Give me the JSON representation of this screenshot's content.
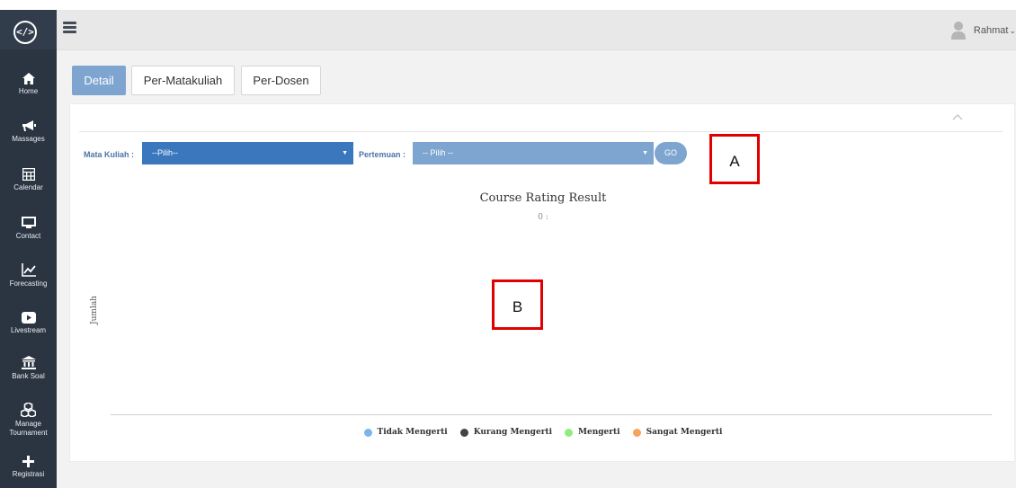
{
  "app": {
    "logo_icon": "code-icon",
    "logo_text": "</>"
  },
  "sidebar": {
    "items": [
      {
        "label": "Home",
        "icon": "home-icon"
      },
      {
        "label": "Massages",
        "icon": "megaphone-icon"
      },
      {
        "label": "Calendar",
        "icon": "calendar-icon"
      },
      {
        "label": "Contact",
        "icon": "monitor-icon"
      },
      {
        "label": "Forecasting",
        "icon": "line-chart-icon"
      },
      {
        "label": "Livestream",
        "icon": "play-icon"
      },
      {
        "label": "Bank Soal",
        "icon": "bank-icon"
      },
      {
        "label": "Manage Tournament",
        "icon": "cubes-icon"
      },
      {
        "label": "Registrasi",
        "icon": "plus-icon"
      }
    ]
  },
  "topbar": {
    "menu_icon": "hamburger-icon",
    "user_name": "Rahmat",
    "user_caret": "⌄"
  },
  "tabs": [
    {
      "label": "Detail",
      "active": true
    },
    {
      "label": "Per-Matakuliah",
      "active": false
    },
    {
      "label": "Per-Dosen",
      "active": false
    }
  ],
  "filters": {
    "mata_kuliah_label": "Mata Kuliah :",
    "mata_kuliah_value": "--Pilih--",
    "pertemuan_label": "Pertemuan :",
    "pertemuan_value": "-- Pilih --",
    "go_label": "GO",
    "mata_kuliah_color": "#3a77bd",
    "pertemuan_color": "#7ea5d0"
  },
  "annotations": {
    "a": "A",
    "b": "B"
  },
  "chart_data": {
    "type": "bar",
    "title": "Course Rating Result",
    "subtitle": "0 :",
    "ylabel": "Jumlah",
    "xlabel": "",
    "categories": [],
    "series": [
      {
        "name": "Tidak Mengerti",
        "color": "#7cb5ec",
        "values": []
      },
      {
        "name": "Kurang Mengerti",
        "color": "#434348",
        "values": []
      },
      {
        "name": "Mengerti",
        "color": "#90ed7d",
        "values": []
      },
      {
        "name": "Sangat Mengerti",
        "color": "#f7a35c",
        "values": []
      }
    ],
    "legend_position": "bottom"
  }
}
